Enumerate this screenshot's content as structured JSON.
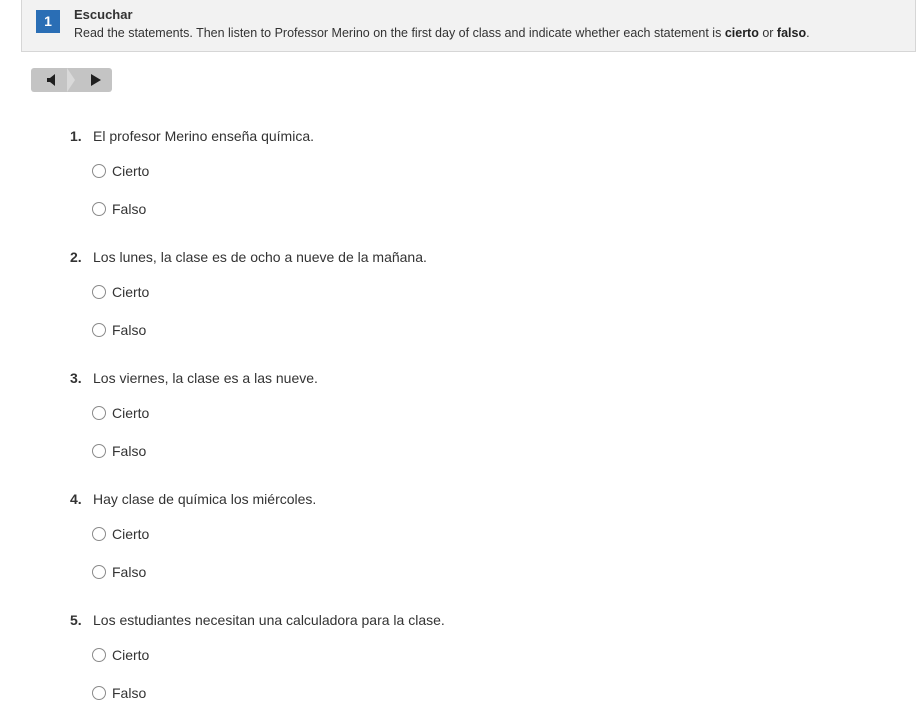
{
  "header": {
    "badge": "1",
    "title": "Escuchar",
    "instructions_prefix": "Read the statements. Then listen to Professor Merino on the first day of class and indicate whether each statement is ",
    "cierto": "cierto",
    "or": " or ",
    "falso": "falso",
    "period": "."
  },
  "player": {
    "volume_icon": "speaker-icon",
    "play_icon": "play-icon"
  },
  "questions": [
    {
      "num": "1.",
      "text": "El profesor Merino enseña química.",
      "options": [
        "Cierto",
        "Falso"
      ]
    },
    {
      "num": "2.",
      "text": "Los lunes, la clase es de ocho a nueve de la mañana.",
      "options": [
        "Cierto",
        "Falso"
      ]
    },
    {
      "num": "3.",
      "text": "Los viernes, la clase es a las nueve.",
      "options": [
        "Cierto",
        "Falso"
      ]
    },
    {
      "num": "4.",
      "text": "Hay clase de química los miércoles.",
      "options": [
        "Cierto",
        "Falso"
      ]
    },
    {
      "num": "5.",
      "text": "Los estudiantes necesitan una calculadora para la clase.",
      "options": [
        "Cierto",
        "Falso"
      ]
    }
  ]
}
